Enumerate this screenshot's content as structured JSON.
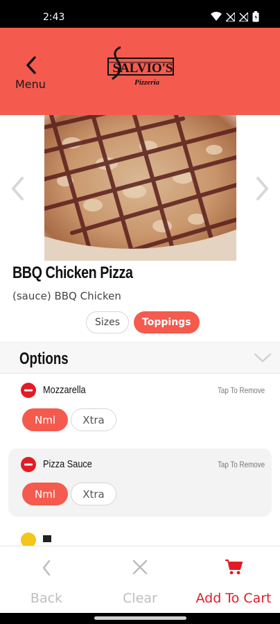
{
  "status_bar": {
    "time": "2:43"
  },
  "header": {
    "back_label": "Menu",
    "logo_text": "SALVIO'S",
    "logo_subtext": "Pizzeria",
    "color": "#f55a4e"
  },
  "item": {
    "title": "BBQ Chicken Pizza",
    "description": "(sauce) BBQ Chicken"
  },
  "tabs": [
    {
      "label": "Sizes",
      "active": false
    },
    {
      "label": "Toppings",
      "active": true
    }
  ],
  "options": {
    "title": "Options",
    "toppings": [
      {
        "name": "Mozzarella",
        "action": "Tap To Remove",
        "choices": [
          "Nml",
          "Xtra"
        ],
        "selected": "Nml"
      },
      {
        "name": "Pizza Sauce",
        "action": "Tap To Remove",
        "choices": [
          "Nml",
          "Xtra"
        ],
        "selected": "Nml"
      }
    ]
  },
  "bottom_bar": {
    "back": "Back",
    "clear": "Clear",
    "add_to_cart": "Add To Cart"
  },
  "colors": {
    "accent": "#f55a4e",
    "cart": "#e31b24",
    "muted": "#bdbdbd"
  }
}
